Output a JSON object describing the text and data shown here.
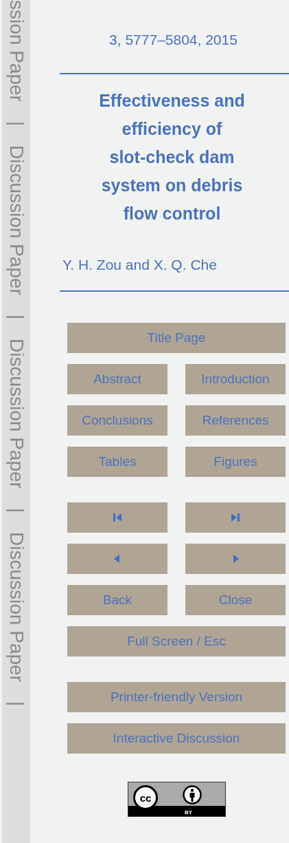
{
  "side_strip": [
    "ssion Paper",
    "|",
    "Discussion Paper",
    "|",
    "Discussion Paper",
    "|",
    "Discussion Paper",
    "|"
  ],
  "citation": "3, 5777–5804, 2015",
  "title": "Effectiveness and efficiency of slot-check dam system on debris flow control",
  "authors": "Y. H. Zou and X. Q. Che",
  "nav_groups": [
    [
      [
        {
          "label": "Title Page"
        }
      ],
      [
        {
          "label": "Abstract"
        },
        {
          "label": "Introduction"
        }
      ],
      [
        {
          "label": "Conclusions"
        },
        {
          "label": "References"
        }
      ],
      [
        {
          "label": "Tables"
        },
        {
          "label": "Figures"
        }
      ]
    ],
    [
      [
        {
          "kind": "first"
        },
        {
          "kind": "last"
        }
      ],
      [
        {
          "kind": "previous"
        },
        {
          "kind": "next"
        }
      ],
      [
        {
          "label": "Back"
        },
        {
          "label": "Close"
        }
      ],
      [
        {
          "label": "Full Screen / Esc"
        }
      ]
    ],
    [
      [
        {
          "label": "Printer-friendly Version"
        }
      ],
      [
        {
          "label": "Interactive Discussion"
        }
      ]
    ]
  ],
  "license": {
    "logo": "cc",
    "label": "BY"
  }
}
